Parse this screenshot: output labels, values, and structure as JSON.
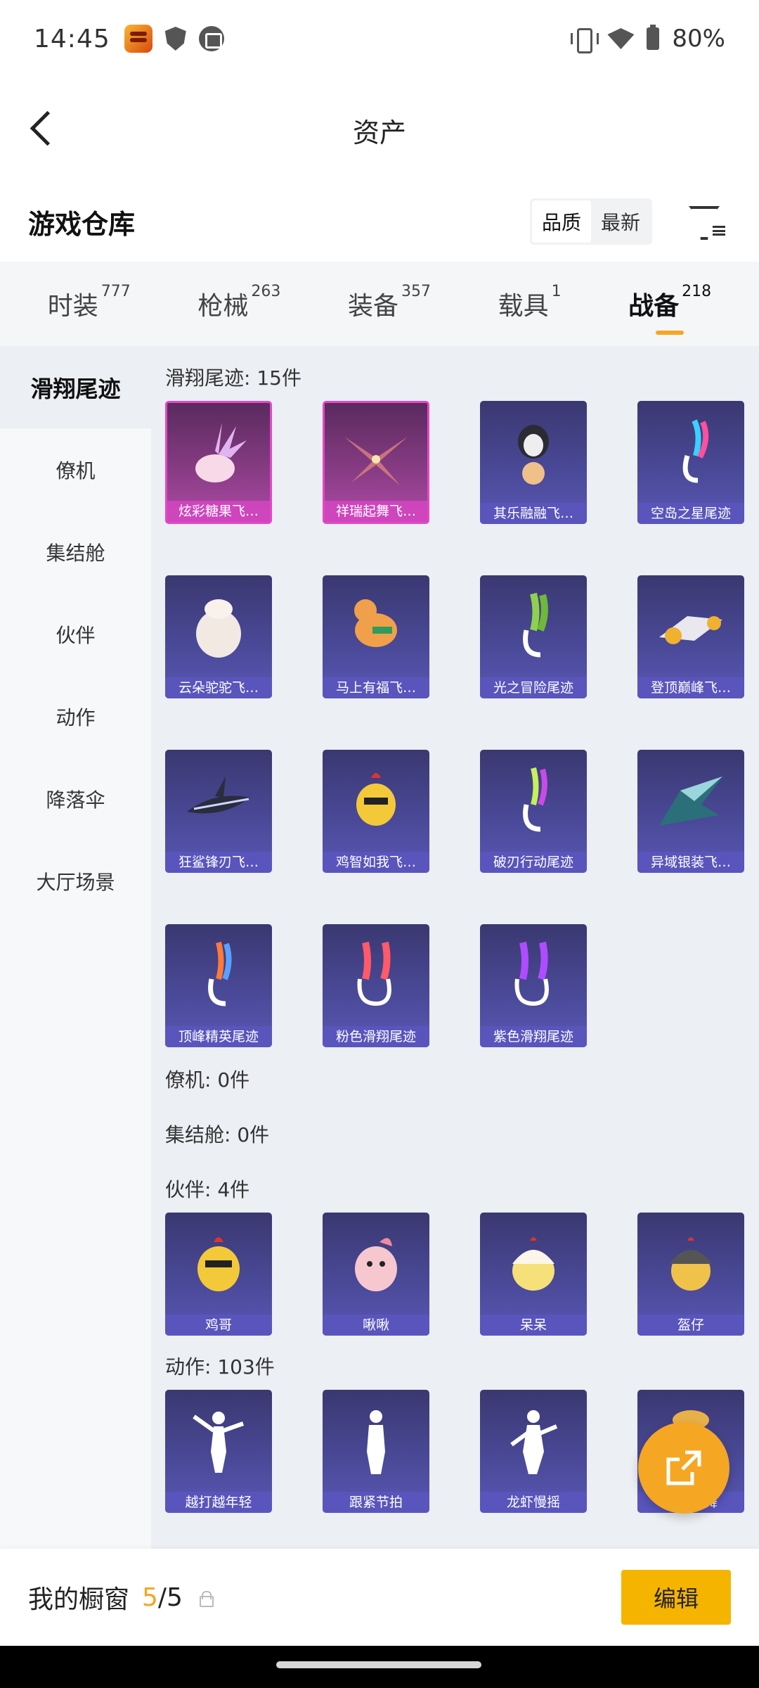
{
  "status_bar": {
    "time": "14:45",
    "battery": "80%",
    "icons": [
      "app-icon",
      "shield-icon",
      "calendar-icon",
      "vibrate-icon",
      "wifi-icon",
      "battery-icon"
    ]
  },
  "header": {
    "title": "资产"
  },
  "warehouse": {
    "title": "游戏仓库",
    "sort_options": [
      "品质",
      "最新"
    ],
    "selected_sort": "品质"
  },
  "tabs": [
    {
      "label": "时装",
      "count": "777"
    },
    {
      "label": "枪械",
      "count": "263"
    },
    {
      "label": "装备",
      "count": "357"
    },
    {
      "label": "载具",
      "count": "1"
    },
    {
      "label": "战备",
      "count": "218"
    }
  ],
  "active_tab": "战备",
  "sidebar": {
    "items": [
      "滑翔尾迹",
      "僚机",
      "集结舱",
      "伙伴",
      "动作",
      "降落伞",
      "大厅场景"
    ],
    "active": "滑翔尾迹"
  },
  "sections": {
    "glide": {
      "title": "滑翔尾迹: 15件",
      "items": [
        "炫彩糖果飞…",
        "祥瑞起舞飞…",
        "其乐融融飞…",
        "空岛之星尾迹",
        "云朵驼驼飞…",
        "马上有福飞…",
        "光之冒险尾迹",
        "登顶巅峰飞…",
        "狂鲨锋刃飞…",
        "鸡智如我飞…",
        "破刃行动尾迹",
        "异域银装飞…",
        "顶峰精英尾迹",
        "粉色滑翔尾迹",
        "紫色滑翔尾迹"
      ]
    },
    "wingman": {
      "title": "僚机: 0件"
    },
    "capsule": {
      "title": "集结舱: 0件"
    },
    "partner": {
      "title": "伙伴: 4件",
      "items": [
        "鸡哥",
        "啾啾",
        "呆呆",
        "盔仔"
      ]
    },
    "action": {
      "title": "动作: 103件",
      "items": [
        "越打越年轻",
        "跟紧节拍",
        "龙虾慢摇",
        "胜利之舞"
      ]
    }
  },
  "bottom_bar": {
    "title": "我的橱窗",
    "current": "5",
    "total": "/5",
    "edit_label": "编辑"
  },
  "colors": {
    "accent": "#f5a623",
    "card_bg": "#4b4a9a",
    "card_pink": "#e447c8"
  }
}
